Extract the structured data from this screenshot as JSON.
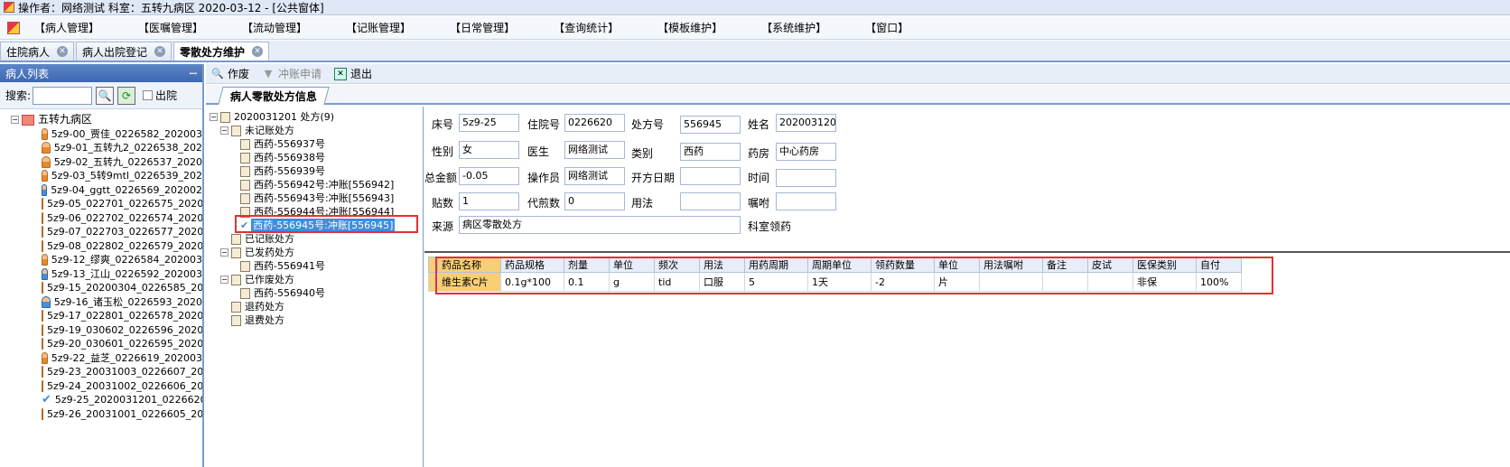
{
  "window": {
    "title": "操作者：网络测试  科室：五转九病区   2020-03-12    - [公共窗体]"
  },
  "menu": [
    "【病人管理】",
    "【医嘱管理】",
    "【流动管理】",
    "【记账管理】",
    "【日常管理】",
    "【查询统计】",
    "【模板维护】",
    "【系统维护】",
    "【窗口】"
  ],
  "tabs": [
    {
      "label": "住院病人",
      "active": false
    },
    {
      "label": "病人出院登记",
      "active": false
    },
    {
      "label": "零散处方维护",
      "active": true
    }
  ],
  "patient_panel": {
    "title": "病人列表",
    "pin": "ꟷ",
    "search_label": "搜索:",
    "search_value": "",
    "discharged_label": "出院",
    "ward": "五转九病区",
    "patients": [
      {
        "label": "5z9-00_贾佳_0226582_202003",
        "kind": "normal"
      },
      {
        "label": "5z9-01_五转九2_0226538_202",
        "kind": "normal"
      },
      {
        "label": "5z9-02_五转九_0226537_2020",
        "kind": "normal"
      },
      {
        "label": "5z9-03_5转9mtl_0226539_202",
        "kind": "normal"
      },
      {
        "label": "5z9-04_ggtt_0226569_202002",
        "kind": "blue"
      },
      {
        "label": "5z9-05_022701_0226575_2020",
        "kind": "normal"
      },
      {
        "label": "5z9-06_022702_0226574_2020",
        "kind": "normal"
      },
      {
        "label": "5z9-07_022703_0226577_2020",
        "kind": "normal"
      },
      {
        "label": "5z9-08_022802_0226579_2020",
        "kind": "normal"
      },
      {
        "label": "5z9-12_缪爽_0226584_202003",
        "kind": "normal"
      },
      {
        "label": "5z9-13_江山_0226592_202003",
        "kind": "blue"
      },
      {
        "label": "5z9-15_20200304_0226585_20",
        "kind": "normal"
      },
      {
        "label": "5z9-16_诸玉松_0226593_2020",
        "kind": "blue"
      },
      {
        "label": "5z9-17_022801_0226578_2020",
        "kind": "normal"
      },
      {
        "label": "5z9-19_030602_0226596_2020",
        "kind": "normal"
      },
      {
        "label": "5z9-20_030601_0226595_2020",
        "kind": "normal"
      },
      {
        "label": "5z9-22_益芝_0226619_202003",
        "kind": "normal"
      },
      {
        "label": "5z9-23_20031003_0226607_20",
        "kind": "normal"
      },
      {
        "label": "5z9-24_20031002_0226606_20",
        "kind": "normal"
      },
      {
        "label": "5z9-25_2020031201_0226620_",
        "kind": "check"
      },
      {
        "label": "5z9-26_20031001_0226605_20",
        "kind": "normal"
      }
    ]
  },
  "toolbar": {
    "void": "作废",
    "reverse": "冲账申请",
    "exit": "退出"
  },
  "subtab": "病人零散处方信息",
  "rx_tree": {
    "root": "2020031201    处方(9)",
    "unbilled": "未记账处方",
    "unbilled_items": [
      "西药-556937号",
      "西药-556938号",
      "西药-556939号",
      "西药-556942号:冲账[556942]",
      "西药-556943号:冲账[556943]",
      "西药-556944号:冲账[556944]"
    ],
    "selected": "西药-556945号:冲账[556945]",
    "billed": "已记账处方",
    "dispensed": "已发药处方",
    "dispensed_items": [
      "西药-556941号"
    ],
    "voided": "已作废处方",
    "voided_items": [
      "西药-556940号"
    ],
    "returned_drug": "退药处方",
    "refund": "退费处方"
  },
  "form": {
    "bed_label": "床号",
    "bed": "5z9-25",
    "admission_label": "住院号",
    "admission": "0226620",
    "rxno_label": "处方号",
    "rxno": "556945",
    "name_label": "姓名",
    "name": "2020031201",
    "sex_label": "性别",
    "sex": "女",
    "doctor_label": "医生",
    "doctor": "网络测试",
    "category_label": "类别",
    "category": "西药",
    "pharmacy_label": "药房",
    "pharmacy": "中心药房",
    "total_label": "总金额",
    "total": "-0.05",
    "operator_label": "操作员",
    "operator": "网络测试",
    "date_label": "开方日期",
    "date": "",
    "time_label": "时间",
    "time": "",
    "doses_label": "贴数",
    "doses": "1",
    "decoct_label": "代煎数",
    "decoct": "0",
    "usage_label": "用法",
    "usage": "",
    "advice_label": "嘱咐",
    "advice": "",
    "source_label": "来源",
    "source": "病区零散处方",
    "dept_pick": "科室领药"
  },
  "grid": {
    "columns": [
      "药品名称",
      "药品规格",
      "剂量",
      "单位",
      "频次",
      "用法",
      "用药周期",
      "周期单位",
      "领药数量",
      "单位",
      "用法嘱咐",
      "备注",
      "皮试",
      "医保类别",
      "自付"
    ],
    "rows": [
      [
        "维生素C片",
        "0.1g*100",
        "0.1",
        "g",
        "tid",
        "口服",
        "5",
        "1天",
        "-2",
        "片",
        "",
        "",
        "",
        "非保",
        "100%"
      ]
    ]
  }
}
